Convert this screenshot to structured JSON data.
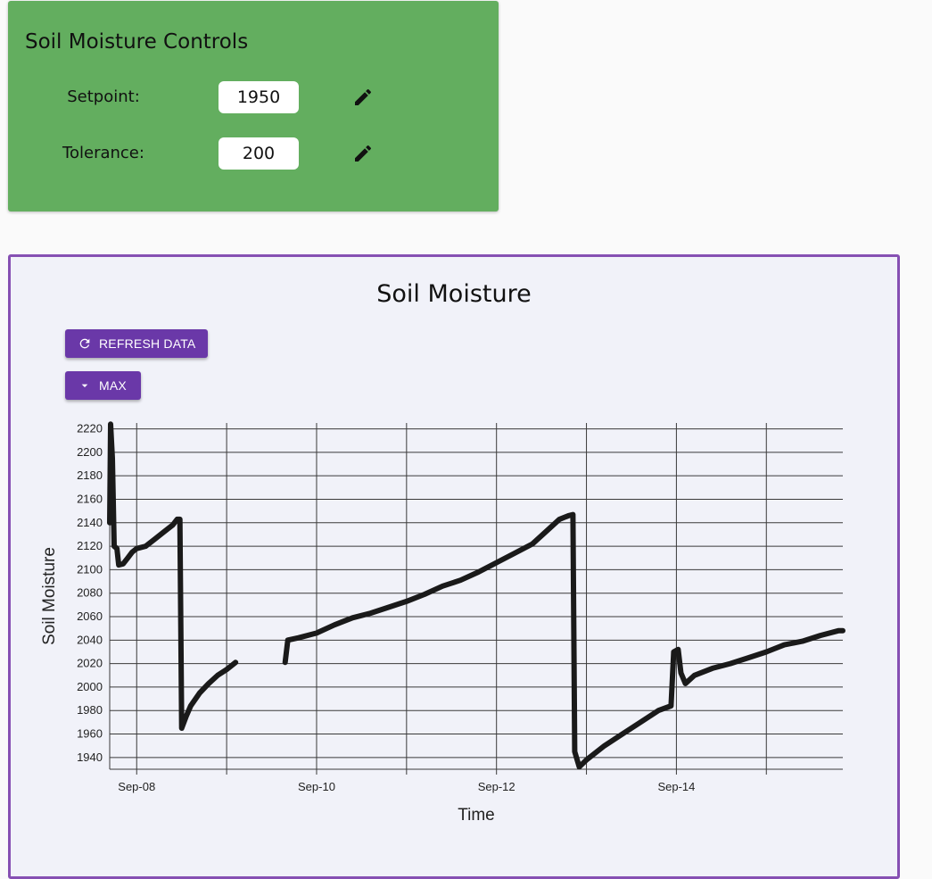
{
  "controls": {
    "title": "Soil Moisture Controls",
    "setpoint_label": "Setpoint:",
    "setpoint_value": "1950",
    "tolerance_label": "Tolerance:",
    "tolerance_value": "200",
    "background_color": "#63ae5f"
  },
  "chart_panel": {
    "refresh_label": "REFRESH DATA",
    "range_label": "MAX",
    "button_color": "#6a38a8",
    "border_color": "#8650b3"
  },
  "chart_data": {
    "type": "line",
    "title": "Soil Moisture",
    "xlabel": "Time",
    "ylabel": "Soil Moisture",
    "x_ticks": [
      "Sep-08",
      "Sep-10",
      "Sep-12",
      "Sep-14"
    ],
    "x_tick_days": [
      8,
      10,
      12,
      14
    ],
    "xlim_days": [
      7.7,
      15.85
    ],
    "ylim": [
      1930,
      2225
    ],
    "y_ticks": [
      1940,
      1960,
      1980,
      2000,
      2020,
      2040,
      2060,
      2080,
      2100,
      2120,
      2140,
      2160,
      2180,
      2200,
      2220
    ],
    "grid": true,
    "line_color": "#1a1a1a",
    "series": [
      {
        "segments": [
          [
            [
              7.7,
              2140
            ],
            [
              7.71,
              2224
            ],
            [
              7.73,
              2195
            ],
            [
              7.75,
              2120
            ],
            [
              7.78,
              2118
            ],
            [
              7.8,
              2104
            ],
            [
              7.85,
              2105
            ],
            [
              7.9,
              2110
            ],
            [
              7.95,
              2115
            ],
            [
              8.0,
              2118
            ],
            [
              8.1,
              2120
            ],
            [
              8.2,
              2126
            ],
            [
              8.3,
              2132
            ],
            [
              8.4,
              2138
            ],
            [
              8.45,
              2143
            ],
            [
              8.48,
              2143
            ],
            [
              8.5,
              1965
            ],
            [
              8.55,
              1975
            ],
            [
              8.6,
              1984
            ],
            [
              8.7,
              1995
            ],
            [
              8.8,
              2003
            ],
            [
              8.9,
              2010
            ],
            [
              9.0,
              2015
            ],
            [
              9.1,
              2021
            ]
          ],
          [
            [
              9.65,
              2021
            ],
            [
              9.68,
              2040
            ],
            [
              9.8,
              2042
            ],
            [
              10.0,
              2046
            ],
            [
              10.2,
              2053
            ],
            [
              10.4,
              2059
            ],
            [
              10.6,
              2063
            ],
            [
              10.8,
              2068
            ],
            [
              11.0,
              2073
            ],
            [
              11.2,
              2079
            ],
            [
              11.4,
              2086
            ],
            [
              11.6,
              2091
            ],
            [
              11.8,
              2098
            ],
            [
              12.0,
              2106
            ],
            [
              12.2,
              2114
            ],
            [
              12.4,
              2122
            ],
            [
              12.6,
              2136
            ],
            [
              12.7,
              2143
            ],
            [
              12.8,
              2146
            ],
            [
              12.85,
              2147
            ],
            [
              12.87,
              1945
            ],
            [
              12.92,
              1932
            ],
            [
              13.0,
              1938
            ],
            [
              13.2,
              1950
            ],
            [
              13.4,
              1960
            ],
            [
              13.6,
              1970
            ],
            [
              13.8,
              1980
            ],
            [
              13.94,
              1984
            ],
            [
              13.97,
              2030
            ],
            [
              14.02,
              2032
            ],
            [
              14.05,
              2012
            ],
            [
              14.1,
              2003
            ],
            [
              14.2,
              2010
            ],
            [
              14.4,
              2016
            ],
            [
              14.6,
              2020
            ],
            [
              14.8,
              2025
            ],
            [
              15.0,
              2030
            ],
            [
              15.1,
              2033
            ],
            [
              15.2,
              2036
            ],
            [
              15.4,
              2039
            ],
            [
              15.6,
              2044
            ],
            [
              15.8,
              2048
            ],
            [
              15.85,
              2048
            ]
          ]
        ]
      }
    ]
  }
}
